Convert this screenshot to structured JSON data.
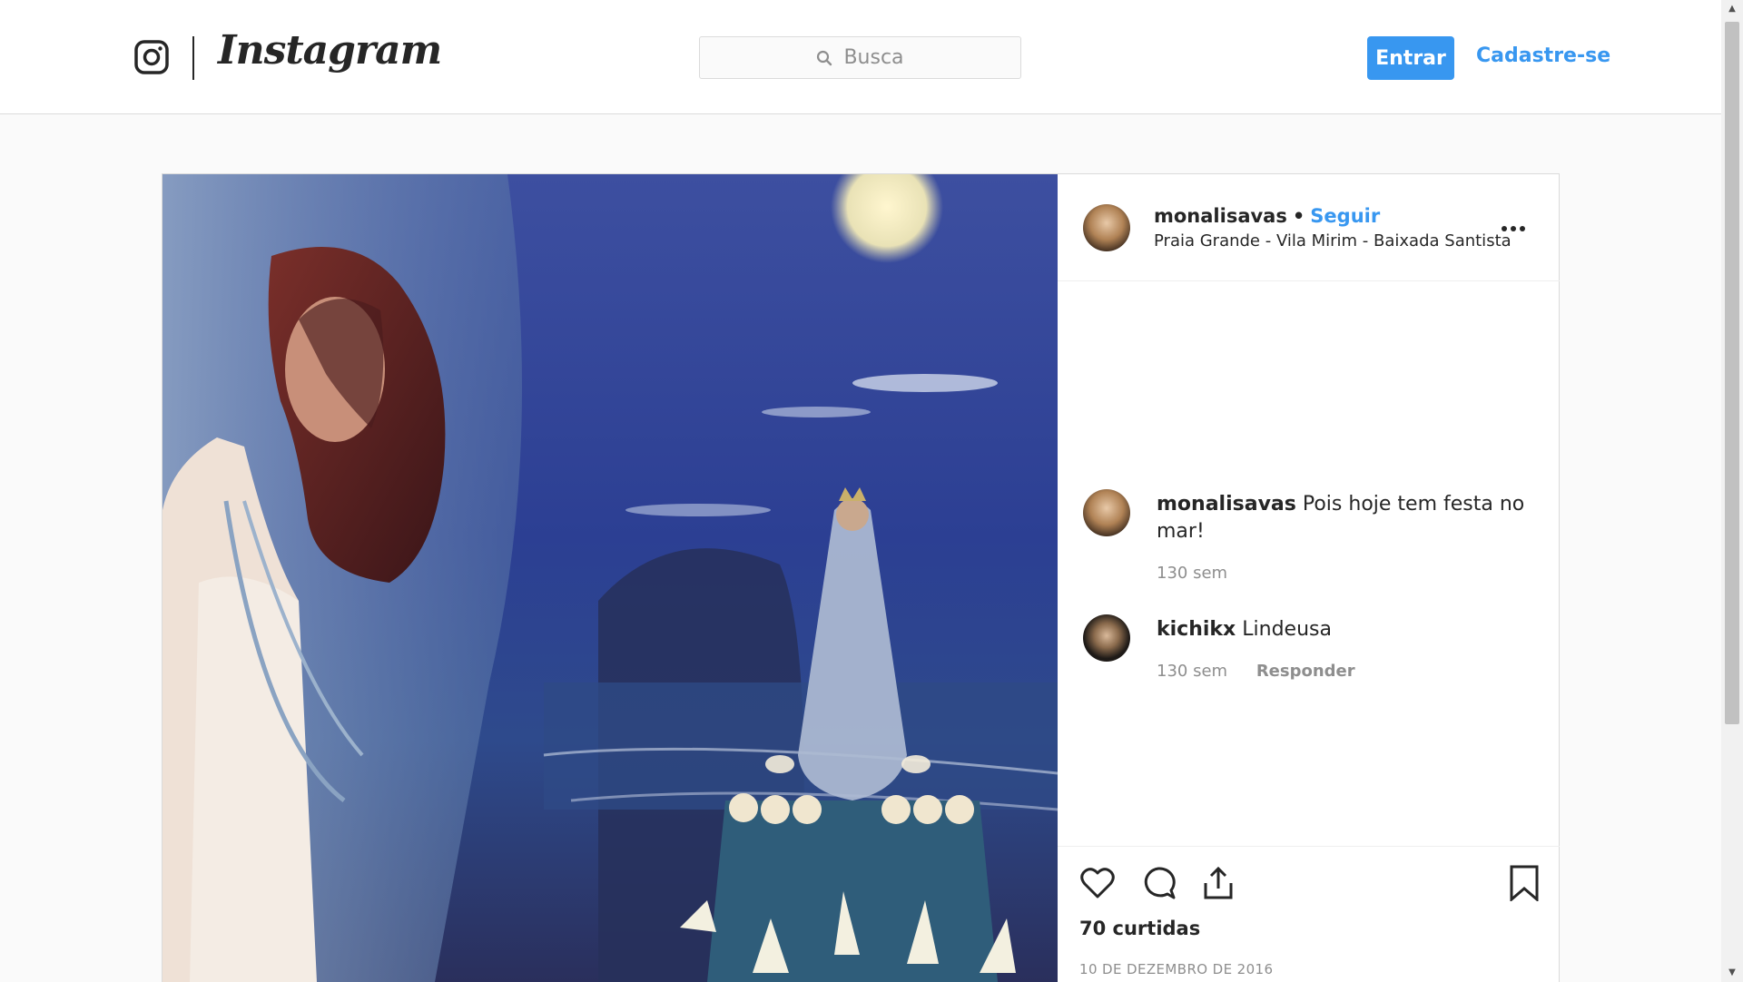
{
  "nav": {
    "logo_text": "Instagram",
    "search_placeholder": "Busca",
    "login_label": "Entrar",
    "signup_label": "Cadastre-se"
  },
  "post": {
    "username": "monalisavas",
    "separator": "•",
    "follow_label": "Seguir",
    "location": "Praia Grande - Vila Mirim - Baixada Santista",
    "comments": [
      {
        "username": "monalisavas",
        "text": "Pois hoje tem festa no mar!",
        "time": "130 sem",
        "reply_label": ""
      },
      {
        "username": "kichikx",
        "text": "Lindeusa",
        "time": "130 sem",
        "reply_label": "Responder"
      }
    ],
    "likes": "70 curtidas",
    "date": "10 DE DEZEMBRO DE 2016"
  },
  "colors": {
    "accent": "#3897f0",
    "text": "#262626",
    "muted": "#8e8e8e",
    "border": "#dbdbdb",
    "background": "#fafafa"
  },
  "icons": {
    "logo": "instagram-glyph-icon",
    "search": "search-icon",
    "more": "more-options-icon",
    "like": "heart-icon",
    "comment": "comment-bubble-icon",
    "share": "share-icon",
    "save": "bookmark-icon"
  }
}
